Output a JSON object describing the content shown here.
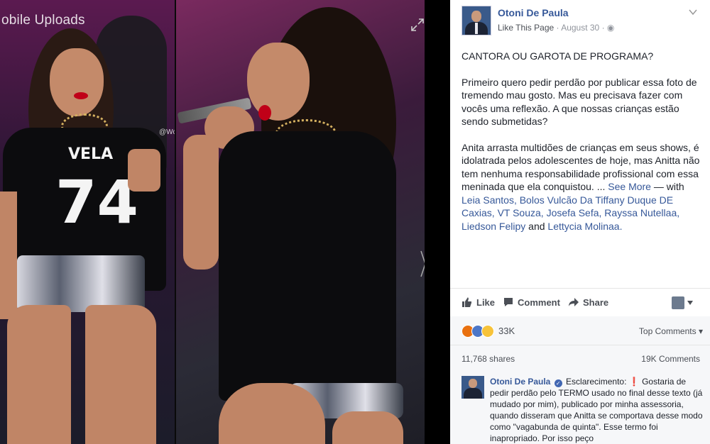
{
  "viewer": {
    "title": "obile Uploads",
    "watermark": "@WorkAnitta",
    "shirt_text_top": "VELA",
    "shirt_number": "74"
  },
  "post": {
    "author": "Otoni De Paula",
    "like_page": "Like This Page",
    "date": "August 30",
    "paragraphs": [
      "CANTORA OU GAROTA DE PROGRAMA?",
      "Primeiro quero pedir perdão por publicar essa foto de tremendo mau gosto. Mas eu precisava fazer com vocês uma reflexão. A que nossas crianças estão sendo submetidas?"
    ],
    "paragraph3": "Anita arrasta multidões de crianças em seus shows, é idolatrada pelos adolescentes de hoje, mas Anitta não tem nenhuma responsabilidade profissional com essa meninada que ela conquistou. ...",
    "see_more": "See More",
    "with_label": "— with",
    "tags": "Leia Santos, Bolos Vulcão Da Tiffany Duque DE Caxias, VT Souza, Josefa Sefa, Rayssa Nutellaa, Liedson Felipy",
    "and_label": "and",
    "last_tag": "Lettycia Molinaa."
  },
  "actions": {
    "like": "Like",
    "comment": "Comment",
    "share": "Share"
  },
  "stats": {
    "reactions": "33K",
    "top_comments": "Top Comments",
    "shares": "11,768 shares",
    "comments": "19K Comments"
  },
  "comment": {
    "author": "Otoni De Paula",
    "text_start": "Esclarecimento:",
    "text": "Gostaria de pedir perdão pelo TERMO usado no final desse texto (já mudado por mim), publicado por minha assessoria, quando disseram que Anitta se comportava desse modo como \"vagabunda de quinta\". Esse termo foi inapropriado. Por isso peço"
  },
  "colors": {
    "link": "#365899",
    "text": "#1d2129",
    "muted": "#90949c"
  }
}
